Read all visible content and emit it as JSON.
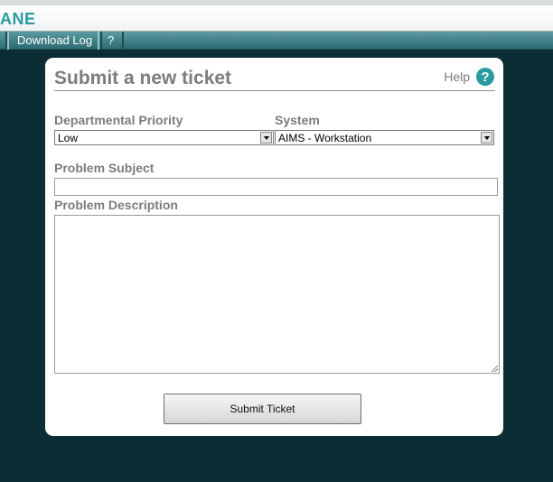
{
  "app": {
    "brand": "ANE"
  },
  "nav": {
    "items": [
      {
        "label": "Download Log"
      },
      {
        "label": "?"
      }
    ]
  },
  "form": {
    "title": "Submit a new ticket",
    "help_label": "Help",
    "help_icon": "question-circle-icon",
    "priority": {
      "label": "Departmental Priority",
      "value": "Low"
    },
    "system": {
      "label": "System",
      "value": "AIMS - Workstation"
    },
    "subject": {
      "label": "Problem Subject",
      "value": ""
    },
    "description": {
      "label": "Problem Description",
      "value": ""
    },
    "submit_label": "Submit Ticket"
  },
  "colors": {
    "background": "#0b2d33",
    "accent": "#2a9ba0",
    "nav": "#2c6b72",
    "label": "#7c7c7c"
  }
}
